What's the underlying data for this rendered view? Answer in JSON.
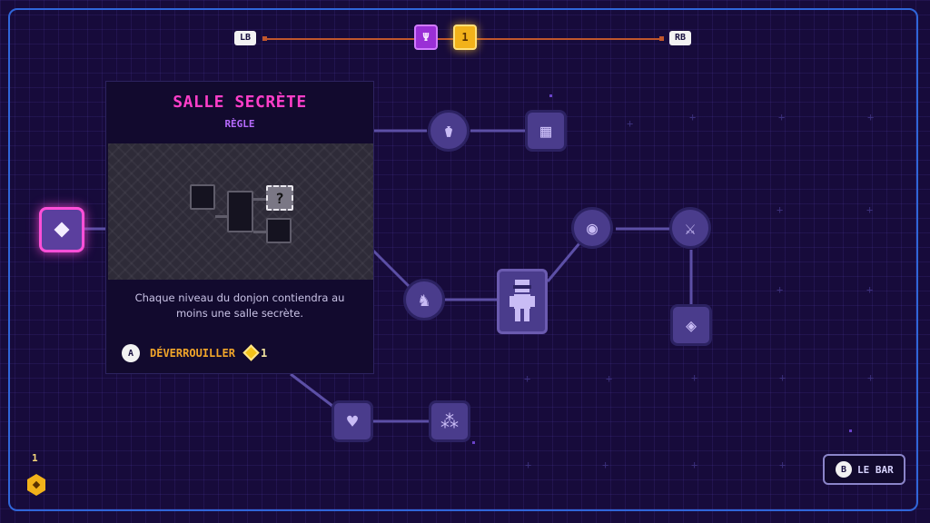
{
  "top_bar": {
    "left_bumper": "LB",
    "right_bumper": "RB",
    "tab_icon": "Ψ",
    "tab_count": "1"
  },
  "tooltip": {
    "title": "SALLE SECRÈTE",
    "subtitle": "RÈGLE",
    "preview_unknown": "?",
    "description": "Chaque niveau du donjon contiendra au moins une salle secrète.",
    "confirm_button": "A",
    "unlock_label": "DÉVERROUILLER",
    "cost": "1"
  },
  "currency": {
    "count": "1"
  },
  "back": {
    "button": "B",
    "label": "LE BAR"
  },
  "nodes": {
    "icons": [
      "fountain-icon",
      "shop-icon",
      "eye-icon",
      "bunny-icon",
      "character-icon",
      "sword-icon",
      "rune-icon",
      "broken-heart-icon",
      "sparkle-door-icon",
      "selected-gem-icon"
    ]
  },
  "colors": {
    "background": "#170b3b",
    "frame": "#2f66d9",
    "accent_pink": "#ff3ec9",
    "gold": "#f2b21a",
    "node": "#4a3c8c"
  }
}
